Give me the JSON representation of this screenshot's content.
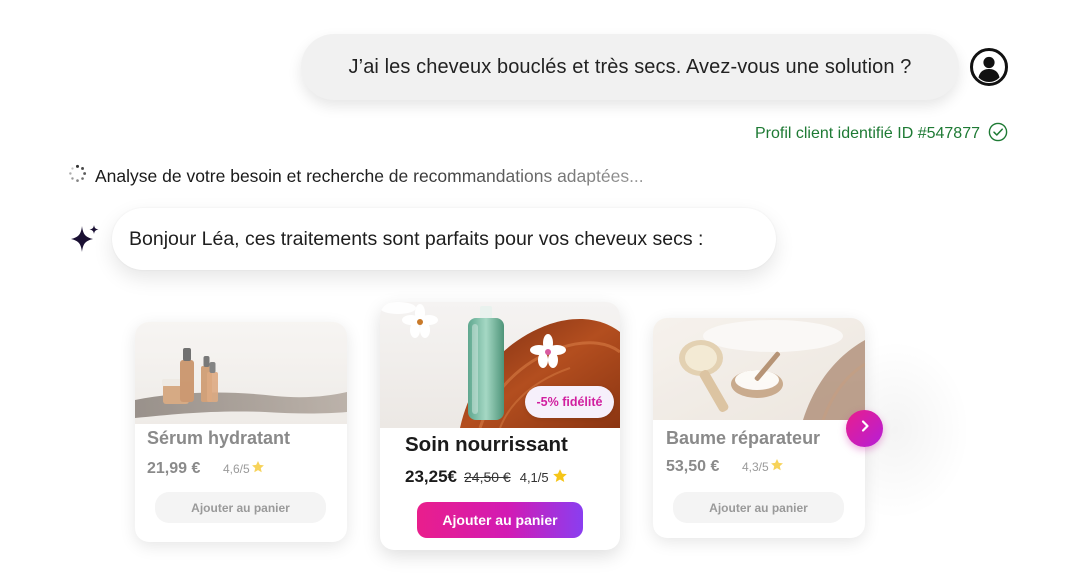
{
  "user_message": "J’ai les cheveux bouclés et très secs. Avez-vous une solution ?",
  "profile_status": "Profil client identifié ID #547877",
  "analysis_status": "Analyse de votre besoin et recherche de recommandations adaptées...",
  "assistant_message": "Bonjour Léa, ces traitements sont parfaits pour vos cheveux secs :",
  "products": [
    {
      "name": "Sérum hydratant",
      "price": "21,99 €",
      "rating": "4,6/5",
      "button": "Ajouter au panier"
    },
    {
      "name": "Soin nourrissant",
      "price": "23,25€",
      "old_price": "24,50 €",
      "rating": "4,1/5",
      "badge": "-5% fidélité",
      "button": "Ajouter au panier"
    },
    {
      "name": "Baume réparateur",
      "price": "53,50 €",
      "rating": "4,3/5",
      "button": "Ajouter au panier"
    }
  ],
  "icons": {
    "avatar": "user-avatar-icon",
    "check": "check-circle-icon",
    "spinner": "loading-spinner-icon",
    "assistant": "sparkle-icon",
    "star": "star-icon",
    "next": "chevron-right-icon"
  },
  "colors": {
    "accent_gradient_start": "#e91e8c",
    "accent_gradient_end": "#8a3ef0",
    "success": "#1e7a34",
    "star": "#f5c518",
    "badge_text": "#d11f9f"
  }
}
